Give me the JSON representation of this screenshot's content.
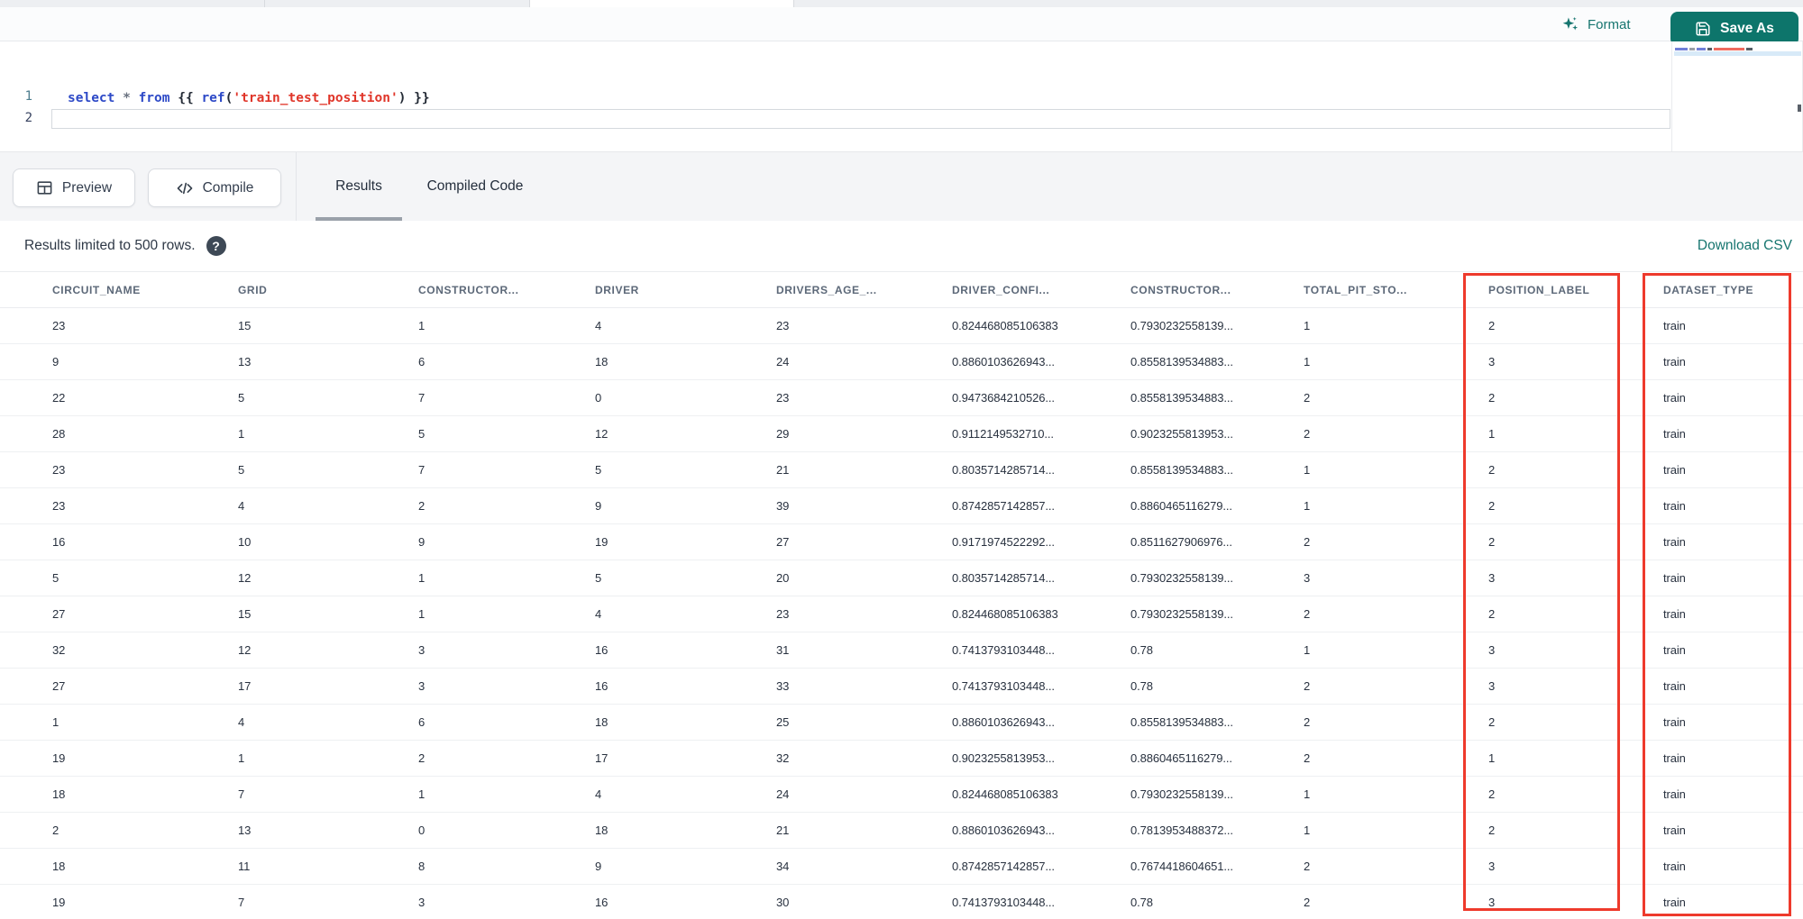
{
  "toolbar": {
    "format_label": "Format",
    "save_as_label": "Save As"
  },
  "editor": {
    "lines": [
      {
        "number": "1",
        "tokens": [
          [
            "select ",
            "kw"
          ],
          [
            "* ",
            "op"
          ],
          [
            "from ",
            "kw"
          ],
          [
            "{{ ",
            "br"
          ],
          [
            "ref",
            "fn"
          ],
          [
            "(",
            "br"
          ],
          [
            "'train_test_position'",
            "str"
          ],
          [
            ") ",
            "br"
          ],
          [
            "}}",
            "br"
          ]
        ]
      },
      {
        "number": "2",
        "tokens": []
      }
    ]
  },
  "actions": {
    "preview_label": "Preview",
    "compile_label": "Compile"
  },
  "result_tabs": {
    "results_label": "Results",
    "compiled_code_label": "Compiled Code",
    "active": "Results"
  },
  "results_bar": {
    "limit_text": "Results limited to 500 rows.",
    "help_icon": "?",
    "download_label": "Download CSV"
  },
  "table": {
    "headers": [
      "CIRCUIT_NAME",
      "GRID",
      "CONSTRUCTOR...",
      "DRIVER",
      "DRIVERS_AGE_...",
      "DRIVER_CONFI...",
      "CONSTRUCTOR...",
      "TOTAL_PIT_STO...",
      "POSITION_LABEL",
      "DATASET_TYPE"
    ],
    "rows": [
      [
        "23",
        "15",
        "1",
        "4",
        "23",
        "0.824468085106383",
        "0.7930232558139...",
        "1",
        "2",
        "train"
      ],
      [
        "9",
        "13",
        "6",
        "18",
        "24",
        "0.8860103626943...",
        "0.8558139534883...",
        "1",
        "3",
        "train"
      ],
      [
        "22",
        "5",
        "7",
        "0",
        "23",
        "0.9473684210526...",
        "0.8558139534883...",
        "2",
        "2",
        "train"
      ],
      [
        "28",
        "1",
        "5",
        "12",
        "29",
        "0.9112149532710...",
        "0.9023255813953...",
        "2",
        "1",
        "train"
      ],
      [
        "23",
        "5",
        "7",
        "5",
        "21",
        "0.8035714285714...",
        "0.8558139534883...",
        "1",
        "2",
        "train"
      ],
      [
        "23",
        "4",
        "2",
        "9",
        "39",
        "0.8742857142857...",
        "0.8860465116279...",
        "1",
        "2",
        "train"
      ],
      [
        "16",
        "10",
        "9",
        "19",
        "27",
        "0.9171974522292...",
        "0.8511627906976...",
        "2",
        "2",
        "train"
      ],
      [
        "5",
        "12",
        "1",
        "5",
        "20",
        "0.8035714285714...",
        "0.7930232558139...",
        "3",
        "3",
        "train"
      ],
      [
        "27",
        "15",
        "1",
        "4",
        "23",
        "0.824468085106383",
        "0.7930232558139...",
        "2",
        "2",
        "train"
      ],
      [
        "32",
        "12",
        "3",
        "16",
        "31",
        "0.7413793103448...",
        "0.78",
        "1",
        "3",
        "train"
      ],
      [
        "27",
        "17",
        "3",
        "16",
        "33",
        "0.7413793103448...",
        "0.78",
        "2",
        "3",
        "train"
      ],
      [
        "1",
        "4",
        "6",
        "18",
        "25",
        "0.8860103626943...",
        "0.8558139534883...",
        "2",
        "2",
        "train"
      ],
      [
        "19",
        "1",
        "2",
        "17",
        "32",
        "0.9023255813953...",
        "0.8860465116279...",
        "2",
        "1",
        "train"
      ],
      [
        "18",
        "7",
        "1",
        "4",
        "24",
        "0.824468085106383",
        "0.7930232558139...",
        "1",
        "2",
        "train"
      ],
      [
        "2",
        "13",
        "0",
        "18",
        "21",
        "0.8860103626943...",
        "0.7813953488372...",
        "1",
        "2",
        "train"
      ],
      [
        "18",
        "11",
        "8",
        "9",
        "34",
        "0.8742857142857...",
        "0.7674418604651...",
        "2",
        "3",
        "train"
      ],
      [
        "19",
        "7",
        "3",
        "16",
        "30",
        "0.7413793103448...",
        "0.78",
        "2",
        "3",
        "train"
      ]
    ]
  },
  "annotations": {
    "highlight_color": "#ee3a2c",
    "highlighted_columns": [
      "POSITION_LABEL",
      "DATASET_TYPE"
    ]
  },
  "colors": {
    "accent_teal": "#0d756b",
    "link_teal": "#16756f"
  }
}
